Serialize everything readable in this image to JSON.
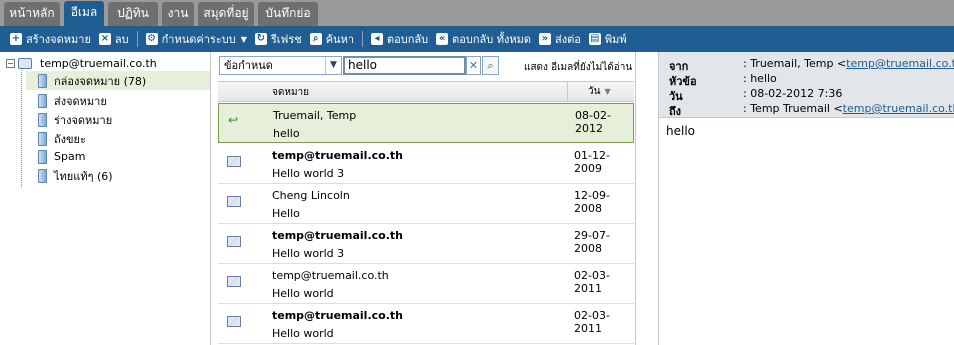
{
  "tabs": [
    {
      "label": "หน้าหลัก"
    },
    {
      "label": "อีเมล"
    },
    {
      "label": "ปฏิทิน"
    },
    {
      "label": "งาน"
    },
    {
      "label": "สมุดที่อยู่"
    },
    {
      "label": "บันทึกย่อ"
    }
  ],
  "active_tab": "อีเมล",
  "toolbar": {
    "new_mail": "สร้างจดหมาย",
    "delete": "ลบ",
    "settings": "กำหนดค่าระบบ",
    "refresh": "รีเฟรช",
    "search": "ค้นหา",
    "reply": "ตอบกลับ",
    "reply_all": "ตอบกลับ ทั้งหมด",
    "forward": "ส่งต่อ",
    "print": "พิมพ์"
  },
  "folders": {
    "account": "temp@truemail.co.th",
    "items": [
      {
        "label": "กล่องจดหมาย (78)"
      },
      {
        "label": "ส่งจดหมาย"
      },
      {
        "label": "ร่างจดหมาย"
      },
      {
        "label": "ถังขยะ"
      },
      {
        "label": "Spam"
      },
      {
        "label": "ไทยแท้ๆ (6)"
      }
    ],
    "selected": "กล่องจดหมาย (78)"
  },
  "filter": {
    "select_value": "ข้อกำหนด",
    "search_value": "hello",
    "unread_link": "แสดง อีเมลที่ยังไม่ได้อ่าน"
  },
  "list": {
    "col_subject": "จดหมาย",
    "col_date": "วัน",
    "messages": [
      {
        "from": "Truemail, Temp",
        "subject": "hello",
        "date": "08-02-2012",
        "unread": false,
        "replied": true
      },
      {
        "from": "temp@truemail.co.th",
        "subject": "Hello world 3",
        "date": "01-12-2009",
        "unread": true,
        "replied": false
      },
      {
        "from": "Cheng Lincoln",
        "subject": "Hello",
        "date": "12-09-2008",
        "unread": false,
        "replied": false
      },
      {
        "from": "temp@truemail.co.th",
        "subject": "Hello world 3",
        "date": "29-07-2008",
        "unread": true,
        "replied": false
      },
      {
        "from": "temp@truemail.co.th",
        "subject": "Hello world",
        "date": "02-03-2011",
        "unread": false,
        "replied": false
      },
      {
        "from": "temp@truemail.co.th",
        "subject": "Hello world",
        "date": "02-03-2011",
        "unread": true,
        "replied": false
      }
    ]
  },
  "preview": {
    "from_label": "จาก",
    "from_name": ": Truemail, Temp <",
    "from_email": "temp@truemail.co.th",
    "from_close": ">",
    "subject_label": "หัวข้อ",
    "subject": ": hello",
    "date_label": "วัน",
    "date": ": 08-02-2012 7:36",
    "to_label": "ถึง",
    "to_name": ": Temp Truemail <",
    "to_email": "temp@truemail.co.th",
    "to_close": ">;",
    "body": "hello"
  },
  "colors": {
    "toolbar": "#205d92",
    "selected_row": "#e6efd9",
    "tabbar": "#9a9a9a"
  }
}
